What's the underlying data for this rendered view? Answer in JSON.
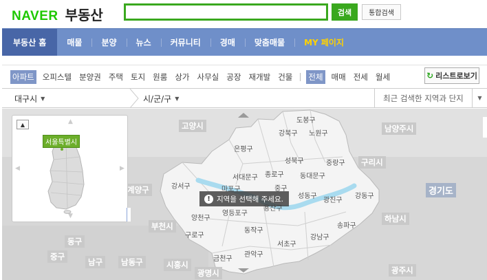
{
  "header": {
    "logo_brand": "NAVER",
    "logo_service": "부동산",
    "search_placeholder": "",
    "search_button": "검색",
    "integrated_search_button": "통합검색"
  },
  "gnb": {
    "items": [
      {
        "label": "부동산 홈",
        "active": true
      },
      {
        "label": "매물",
        "active": false
      },
      {
        "label": "분양",
        "active": false
      },
      {
        "label": "뉴스",
        "active": false
      },
      {
        "label": "커뮤니티",
        "active": false
      },
      {
        "label": "경매",
        "active": false
      },
      {
        "label": "맞춤매물",
        "active": false
      },
      {
        "label": "MY 페이지",
        "active": false
      }
    ]
  },
  "filters": {
    "types": [
      "아파트",
      "오피스텔",
      "분양권",
      "주택",
      "토지",
      "원룸",
      "상가",
      "사무실",
      "공장",
      "재개발",
      "건물"
    ],
    "active_type": "아파트",
    "deals": [
      "전체",
      "매매",
      "전세",
      "월세"
    ],
    "active_deal": "전체",
    "list_view_button": "리스트로보기"
  },
  "region_select": {
    "city": "대구시",
    "district": "시/군/구",
    "recent_placeholder": "최근 검색한 지역과 단지"
  },
  "map": {
    "notice": "지역을 선택해 주세요.",
    "minimap_label": "서울특별시",
    "place_labels": [
      "고양시",
      "남양주시",
      "구리시",
      "경기도",
      "하남시",
      "계양구",
      "부천시",
      "동구",
      "중구",
      "남구",
      "남동구",
      "시흥시",
      "광명시",
      "광주시"
    ],
    "district_labels": [
      "도봉구",
      "강북구",
      "노원구",
      "은평구",
      "성북구",
      "중랑구",
      "서대문구",
      "종로구",
      "동대문구",
      "마포구",
      "중구",
      "강서구",
      "성동구",
      "광진구",
      "강동구",
      "용산구",
      "영등포구",
      "양천구",
      "구로구",
      "동작구",
      "송파구",
      "강남구",
      "서초구",
      "관악구",
      "금천구"
    ]
  },
  "colors": {
    "naver_green": "#1ec800",
    "search_green": "#3aa81e",
    "gnb_blue": "#6f8fc9",
    "gnb_active": "#4866a7",
    "my_page_yellow": "#ffd200",
    "river": "#a9dbef"
  }
}
